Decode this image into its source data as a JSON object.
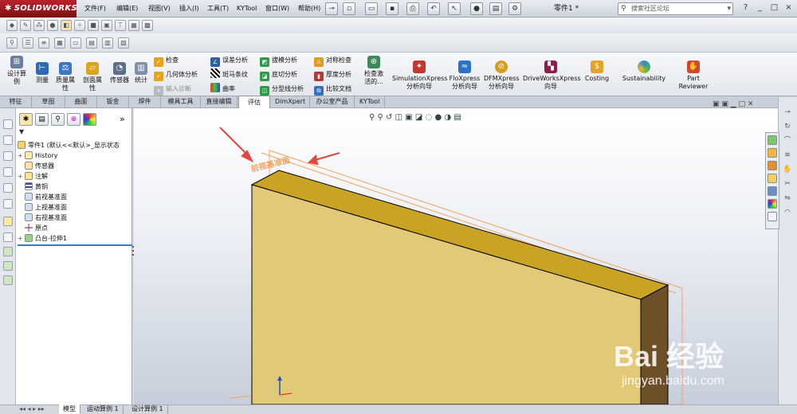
{
  "app": {
    "brand": "SOLIDWORKS",
    "doc_title": "零件1 *"
  },
  "menus": [
    "文件(F)",
    "编辑(E)",
    "视图(V)",
    "插入(I)",
    "工具(T)",
    "KYTool",
    "窗口(W)",
    "帮助(H)"
  ],
  "search": {
    "placeholder": "搜索社区论坛"
  },
  "window_buttons": [
    "?",
    "_",
    "□",
    "×"
  ],
  "cmd": {
    "big_left": [
      "设计算例",
      "测量",
      "质量属性",
      "剖面属性",
      "传感器",
      "统计"
    ],
    "checks": [
      "检查",
      "几何体分析",
      "输入诊断"
    ],
    "col2": [
      "误差分析",
      "斑马条纹",
      "曲率"
    ],
    "col3": [
      "拔模分析",
      "底切分析",
      "分型线分析"
    ],
    "col4": [
      "对称检查",
      "厚度分析",
      "比较文档"
    ],
    "big_right": [
      "检查激活的...",
      "SimulationXpress分析向导",
      "FloXpress分析向导",
      "DFMXpress分析向导",
      "DriveWorksXpress向导",
      "Costing",
      "Sustainability",
      "Part Reviewer"
    ]
  },
  "tabs": [
    "特征",
    "草图",
    "曲面",
    "钣金",
    "焊件",
    "模具工具",
    "直接编辑",
    "评估",
    "DimXpert",
    "办公室产品",
    "KYTool"
  ],
  "active_tab": "评估",
  "tree": {
    "root": "零件1 (默认<<默认>_显示状态",
    "items": [
      "History",
      "传感器",
      "注解",
      "黄铜",
      "前视基准面",
      "上视基准面",
      "右视基准面",
      "原点",
      "凸台-拉伸1"
    ]
  },
  "model": {
    "front_face_label": "前视基准面"
  },
  "bottom_tabs": [
    "模型",
    "运动算例 1",
    "设计算例 1"
  ],
  "watermark": {
    "brand": "Bai 经验",
    "url": "jingyan.baidu.com"
  },
  "colors": {
    "part_face": "#e2c978",
    "part_top": "#c9a324",
    "part_side": "#6e5028",
    "plane": "#f6a25e",
    "arrow": "#e2483c"
  }
}
